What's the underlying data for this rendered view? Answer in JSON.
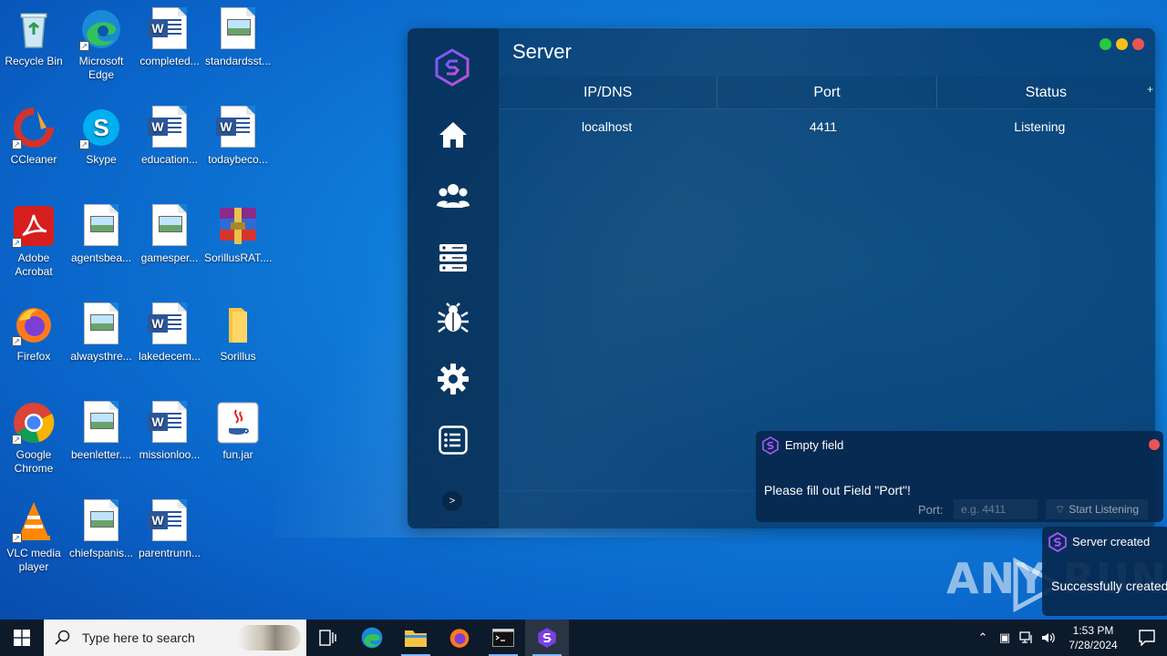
{
  "desktop": {
    "icons": [
      {
        "label": "Recycle Bin"
      },
      {
        "label": "Microsoft Edge"
      },
      {
        "label": "completed..."
      },
      {
        "label": "standardsst..."
      },
      {
        "label": "CCleaner"
      },
      {
        "label": "Skype"
      },
      {
        "label": "education..."
      },
      {
        "label": "todaybeco..."
      },
      {
        "label": "Adobe Acrobat"
      },
      {
        "label": "agentsbea..."
      },
      {
        "label": "gamesper..."
      },
      {
        "label": "SorillusRAT...."
      },
      {
        "label": "Firefox"
      },
      {
        "label": "alwaysthre..."
      },
      {
        "label": "lakedecem..."
      },
      {
        "label": "Sorillus"
      },
      {
        "label": "Google Chrome"
      },
      {
        "label": "beenletter...."
      },
      {
        "label": "missionloo..."
      },
      {
        "label": "fun.jar"
      },
      {
        "label": "VLC media player"
      },
      {
        "label": "chiefspanis..."
      },
      {
        "label": "parentrunn..."
      }
    ]
  },
  "app": {
    "title": "Server",
    "table": {
      "columns": [
        "IP/DNS",
        "Port",
        "Status"
      ],
      "add_symbol": "+",
      "rows": [
        {
          "ip": "localhost",
          "port": "4411",
          "status": "Listening"
        }
      ]
    },
    "expand_label": ">",
    "nav": [
      "home-icon",
      "users-icon",
      "server-list-icon",
      "bug-icon",
      "gear-icon",
      "list-icon"
    ],
    "accent": "#a855f7"
  },
  "notifications": {
    "empty_field": {
      "title": "Empty field",
      "message": "Please fill out Field \"Port\"!"
    },
    "server_created": {
      "title": "Server created",
      "message": "Successfully created"
    }
  },
  "listen_form": {
    "port_label": "Port:",
    "port_placeholder": "e.g. 4411",
    "start_label": "Start Listening"
  },
  "watermark": "ANY RUN",
  "taskbar": {
    "search_placeholder": "Type here to search",
    "time": "1:53 PM",
    "date": "7/28/2024"
  }
}
